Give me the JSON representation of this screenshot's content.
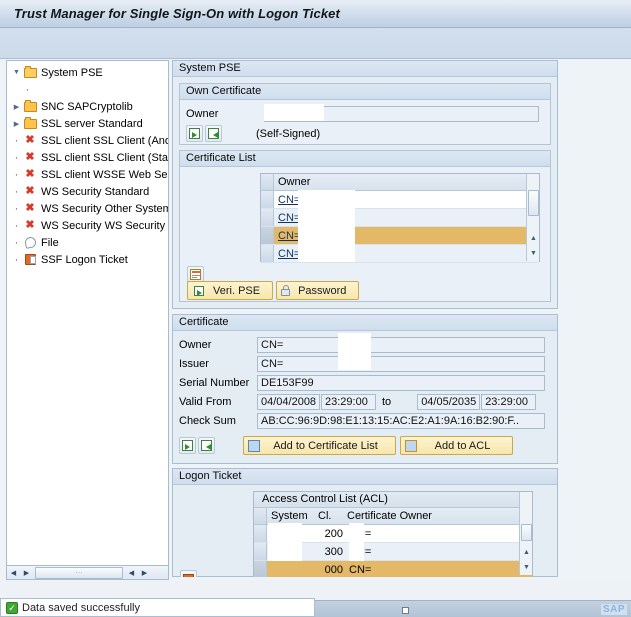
{
  "window": {
    "title": "Trust Manager for Single Sign-On with Logon Ticket"
  },
  "tree": {
    "items": [
      {
        "label": "System PSE",
        "icon": "folder-open-icon",
        "marker": "twisty-down"
      },
      {
        "label": "",
        "icon": "none",
        "marker": "dot"
      },
      {
        "label": "SNC SAPCryptolib",
        "icon": "folder-icon",
        "marker": "twisty-right"
      },
      {
        "label": "SSL server Standard",
        "icon": "folder-icon",
        "marker": "twisty-right"
      },
      {
        "label": "SSL client SSL Client (Anonym",
        "icon": "red-x-icon",
        "marker": "dot"
      },
      {
        "label": "SSL client SSL Client (Standa",
        "icon": "red-x-icon",
        "marker": "dot"
      },
      {
        "label": "SSL client WSSE Web Servic",
        "icon": "red-x-icon",
        "marker": "dot"
      },
      {
        "label": "WS Security Standard",
        "icon": "red-x-icon",
        "marker": "dot"
      },
      {
        "label": "WS Security Other System E",
        "icon": "red-x-icon",
        "marker": "dot"
      },
      {
        "label": "WS Security WS Security Key",
        "icon": "red-x-icon",
        "marker": "dot"
      },
      {
        "label": "File",
        "icon": "shield-icon",
        "marker": "dot"
      },
      {
        "label": "SSF Logon Ticket",
        "icon": "ticket-icon",
        "marker": "dot"
      }
    ]
  },
  "system_pse": {
    "group_title": "System PSE",
    "own_certificate": {
      "group_title": "Own Certificate",
      "owner_label": "Owner",
      "owner_value": "",
      "self_signed_text": "(Self-Signed)",
      "export_icon": "export-certificate-icon",
      "import_icon": "import-certificate-icon"
    },
    "certificate_list": {
      "group_title": "Certificate List",
      "column_owner": "Owner",
      "rows": [
        {
          "owner": "CN=",
          "selected": false
        },
        {
          "owner": "CN=",
          "selected": false
        },
        {
          "owner": "CN=",
          "selected": true
        },
        {
          "owner": "CN=",
          "selected": false
        }
      ],
      "detail_icon": "certificate-details-icon",
      "verify_pse_button": "Veri. PSE",
      "password_button": "Password"
    }
  },
  "certificate": {
    "group_title": "Certificate",
    "owner_label": "Owner",
    "owner_value": "CN=",
    "issuer_label": "Issuer",
    "issuer_value": "CN=",
    "serial_label": "Serial Number",
    "serial_value": "DE153F99",
    "valid_from_label": "Valid From",
    "valid_from_date": "04/04/2008",
    "valid_from_time": "23:29:00",
    "to_text": "to",
    "valid_to_date": "04/05/2035",
    "valid_to_time": "23:29:00",
    "checksum_label": "Check Sum",
    "checksum_value": "AB:CC:96:9D:98:E1:13:15:AC:E2:A1:9A:16:B2:90:F..",
    "export_icon": "export-certificate-icon",
    "import_icon": "import-certificate-icon",
    "add_to_certificate_list_button": "Add to Certificate List",
    "add_to_acl_button": "Add to ACL"
  },
  "logon_ticket": {
    "group_title": "Logon Ticket",
    "acl_caption": "Access Control List (ACL)",
    "columns": [
      "System",
      "Cl.",
      "Certificate Owner"
    ],
    "rows": [
      {
        "system": "",
        "client": "200",
        "owner": "CN=",
        "selected": false
      },
      {
        "system": "",
        "client": "300",
        "owner": "CN=",
        "selected": false
      },
      {
        "system": "",
        "client": "000",
        "owner": "CN=",
        "selected": true
      },
      {
        "system": "",
        "client": "",
        "owner": "",
        "selected": false
      }
    ],
    "delete_icon": "delete-entry-icon"
  },
  "statusbar": {
    "message": "Data saved successfully",
    "status_icon": "success-check-icon",
    "logo": "SAP"
  },
  "colors": {
    "selection": "#e3b968",
    "title_bar": "#cfdcea",
    "panel": "#e4ecf4",
    "button": "#f7e7ac",
    "error_icon": "#d53a2a",
    "success_icon": "#3ea832"
  }
}
